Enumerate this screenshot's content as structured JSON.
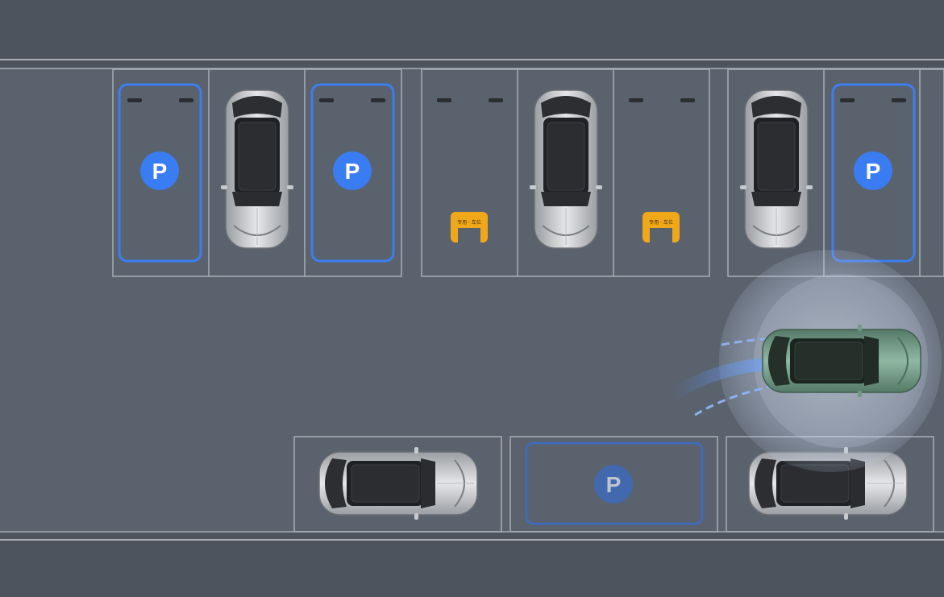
{
  "scene": {
    "colors": {
      "background": "#4d545e",
      "lane": "#5a626d",
      "line": "#a9aeb5",
      "available_slot": "#3d7df0",
      "badge": "#3a7cf2",
      "lock": "#f0a81a",
      "ego_car": "#6f9a86",
      "parked_car": "#c8cacd",
      "sensor": "#c7d8f0"
    },
    "parking_badge_label": "P",
    "lock_label": "专用 · 车位",
    "slots_top": [
      {
        "state": "available"
      },
      {
        "state": "occupied"
      },
      {
        "state": "available"
      },
      {
        "state": "locked"
      },
      {
        "state": "occupied"
      },
      {
        "state": "locked"
      },
      {
        "state": "occupied"
      },
      {
        "state": "available"
      }
    ],
    "slots_bottom": [
      {
        "state": "occupied"
      },
      {
        "state": "target"
      },
      {
        "state": "occupied"
      }
    ],
    "ego_vehicle": {
      "state": "parking-in-progress",
      "color_name": "green"
    }
  }
}
